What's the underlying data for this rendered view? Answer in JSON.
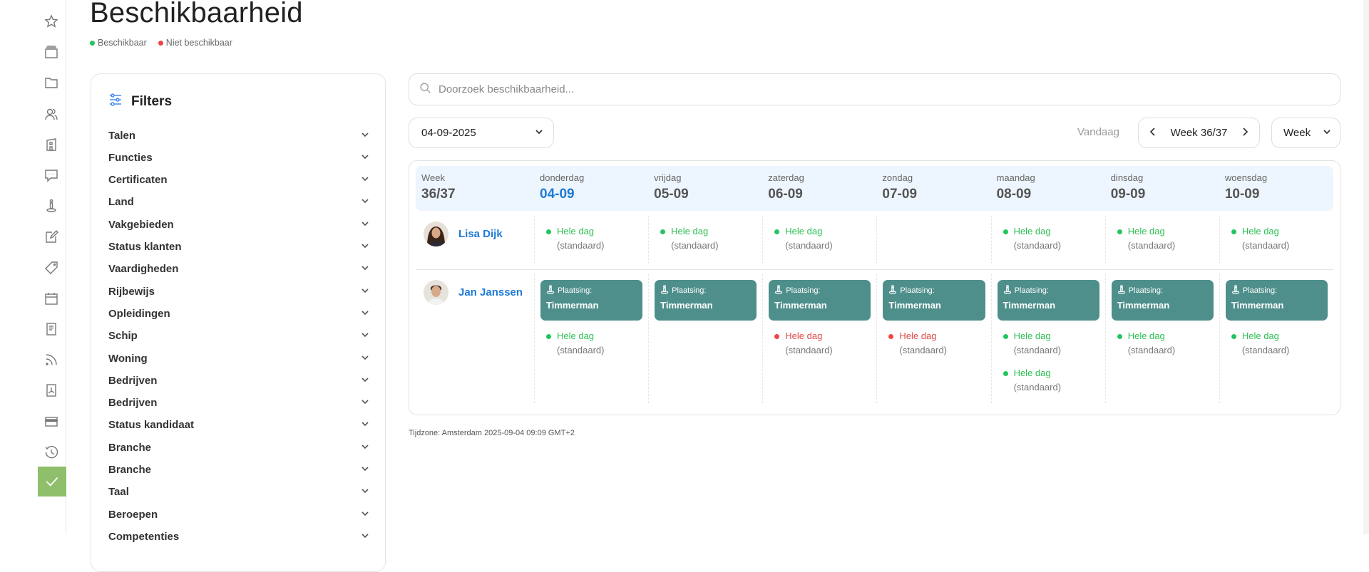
{
  "sidebar": {
    "icons": [
      "star-icon",
      "archive-icon",
      "folder-icon",
      "users-icon",
      "building-icon",
      "chat-icon",
      "placement-icon",
      "edit-icon",
      "tag-icon",
      "calendar-icon",
      "document-icon",
      "rss-icon",
      "pdf-icon",
      "credit-card-icon",
      "history-icon"
    ],
    "active_icon": "check-icon"
  },
  "page": {
    "title": "Beschikbaarheid"
  },
  "legend": [
    {
      "label": "Beschikbaar",
      "color": "#22c55e"
    },
    {
      "label": "Niet beschikbaar",
      "color": "#ef4444"
    }
  ],
  "filters": {
    "title": "Filters",
    "items": [
      "Talen",
      "Functies",
      "Certificaten",
      "Land",
      "Vakgebieden",
      "Status klanten",
      "Vaardigheden",
      "Rijbewijs",
      "Opleidingen",
      "Schip",
      "Woning",
      "Bedrijven",
      "Bedrijven",
      "Status kandidaat",
      "Branche",
      "Branche",
      "Taal",
      "Beroepen",
      "Competenties"
    ]
  },
  "search": {
    "placeholder": "Doorzoek beschikbaarheid...",
    "value": ""
  },
  "toolbar": {
    "date": "04-09-2025",
    "today_label": "Vandaag",
    "week_label": "Week 36/37",
    "view": "Week"
  },
  "calendar": {
    "week_label": "Week",
    "week_value": "36/37",
    "days": [
      {
        "name": "donderdag",
        "date": "04-09",
        "today": true
      },
      {
        "name": "vrijdag",
        "date": "05-09"
      },
      {
        "name": "zaterdag",
        "date": "06-09"
      },
      {
        "name": "zondag",
        "date": "07-09"
      },
      {
        "name": "maandag",
        "date": "08-09"
      },
      {
        "name": "dinsdag",
        "date": "09-09"
      },
      {
        "name": "woensdag",
        "date": "10-09"
      }
    ],
    "people": [
      {
        "name": "Lisa Dijk",
        "avatar": "female",
        "days": [
          {
            "placement": null,
            "statuses": [
              {
                "label": "Hele dag",
                "note": "(standaard)",
                "available": true
              }
            ]
          },
          {
            "placement": null,
            "statuses": [
              {
                "label": "Hele dag",
                "note": "(standaard)",
                "available": true
              }
            ]
          },
          {
            "placement": null,
            "statuses": [
              {
                "label": "Hele dag",
                "note": "(standaard)",
                "available": true
              }
            ]
          },
          {
            "placement": null,
            "statuses": []
          },
          {
            "placement": null,
            "statuses": [
              {
                "label": "Hele dag",
                "note": "(standaard)",
                "available": true
              }
            ]
          },
          {
            "placement": null,
            "statuses": [
              {
                "label": "Hele dag",
                "note": "(standaard)",
                "available": true
              }
            ]
          },
          {
            "placement": null,
            "statuses": [
              {
                "label": "Hele dag",
                "note": "(standaard)",
                "available": true
              }
            ]
          }
        ]
      },
      {
        "name": "Jan Janssen",
        "avatar": "male",
        "days": [
          {
            "placement": {
              "label": "Plaatsing:",
              "value": "Timmerman"
            },
            "statuses": [
              {
                "label": "Hele dag",
                "note": "(standaard)",
                "available": true
              }
            ]
          },
          {
            "placement": {
              "label": "Plaatsing:",
              "value": "Timmerman"
            },
            "statuses": []
          },
          {
            "placement": {
              "label": "Plaatsing:",
              "value": "Timmerman"
            },
            "statuses": [
              {
                "label": "Hele dag",
                "note": "(standaard)",
                "available": false
              }
            ]
          },
          {
            "placement": {
              "label": "Plaatsing:",
              "value": "Timmerman"
            },
            "statuses": [
              {
                "label": "Hele dag",
                "note": "(standaard)",
                "available": false
              }
            ]
          },
          {
            "placement": {
              "label": "Plaatsing:",
              "value": "Timmerman"
            },
            "statuses": [
              {
                "label": "Hele dag",
                "note": "(standaard)",
                "available": true
              },
              {
                "label": "Hele dag",
                "note": "(standaard)",
                "available": true
              }
            ]
          },
          {
            "placement": {
              "label": "Plaatsing:",
              "value": "Timmerman"
            },
            "statuses": [
              {
                "label": "Hele dag",
                "note": "(standaard)",
                "available": true
              }
            ]
          },
          {
            "placement": {
              "label": "Plaatsing:",
              "value": "Timmerman"
            },
            "statuses": [
              {
                "label": "Hele dag",
                "note": "(standaard)",
                "available": true
              }
            ]
          }
        ]
      }
    ]
  },
  "colors": {
    "available": "#22c55e",
    "unavailable": "#ef4444",
    "available_text": "#2fbf55",
    "unavailable_text": "#e04848",
    "placement": "#4e8f8b",
    "link": "#1e7ad6"
  },
  "footer": {
    "timezone": "Tijdzone: Amsterdam 2025-09-04 09:09 GMT+2"
  }
}
